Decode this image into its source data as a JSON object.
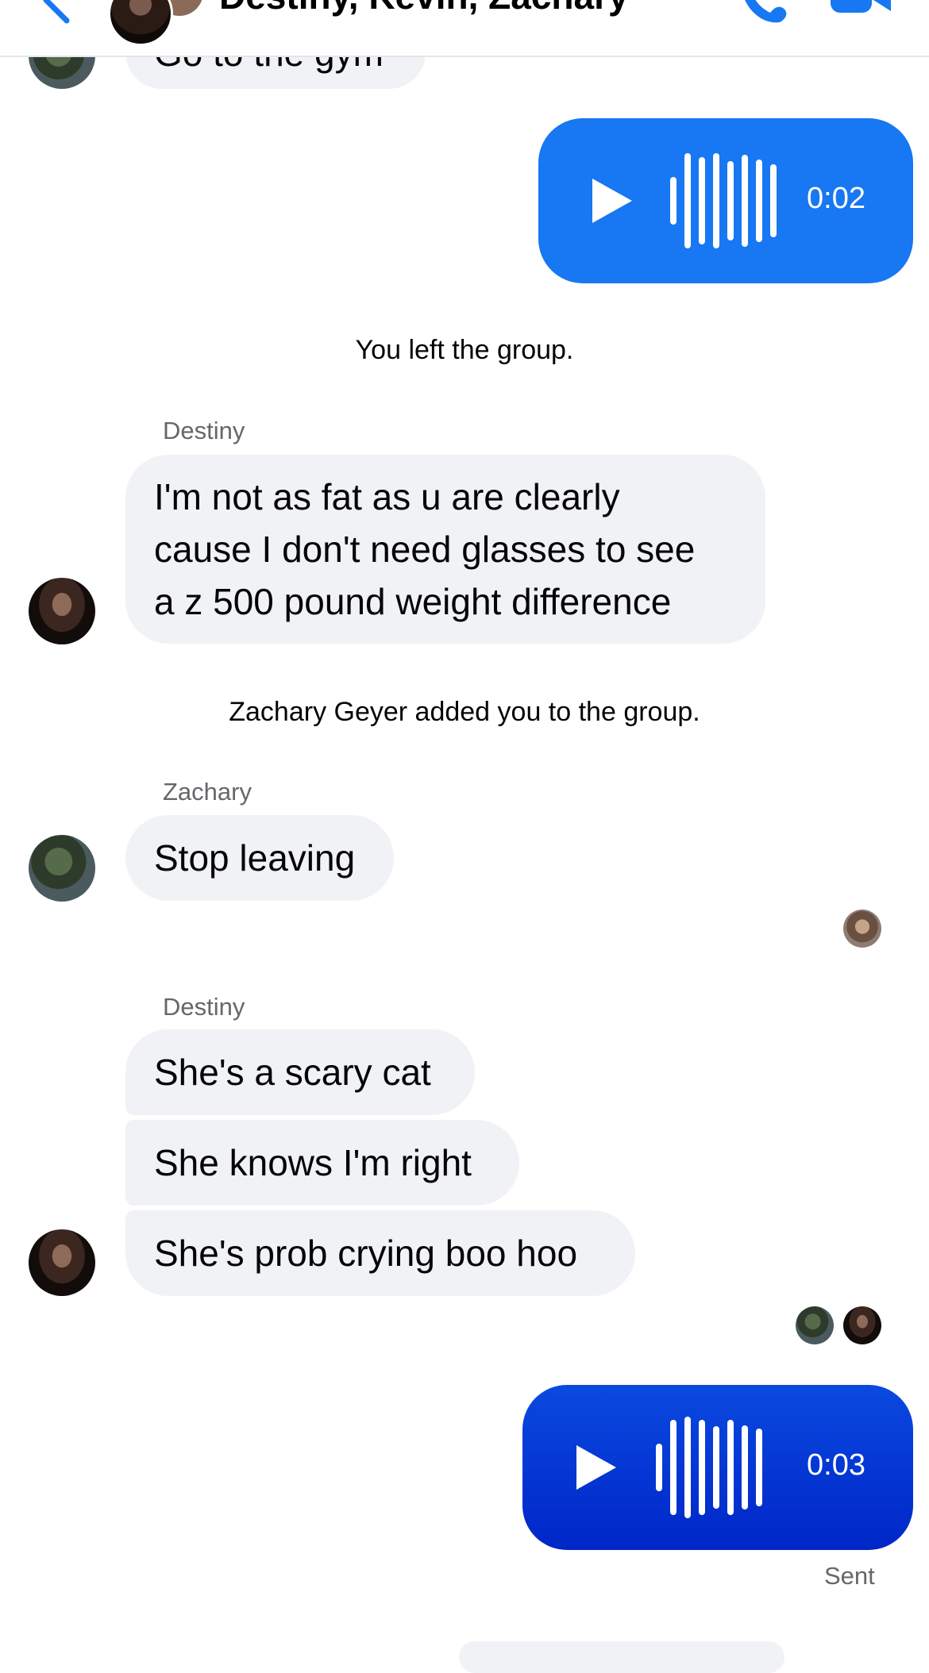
{
  "header": {
    "title": "Destiny, Kevin, Zachary"
  },
  "messages": {
    "gym_text": "Go to the gym",
    "audio1_duration": "0:02",
    "system_left": "You left the group.",
    "destiny_name_1": "Destiny",
    "destiny_msg_1_line1": "I'm not as fat as u are clearly",
    "destiny_msg_1_line2": "cause I don't need glasses to see",
    "destiny_msg_1_line3": "a z 500 pound weight difference",
    "system_added": "Zachary Geyer added you to the group.",
    "zachary_name": "Zachary",
    "zachary_msg": "Stop leaving",
    "destiny_name_2": "Destiny",
    "destiny_msg_2": "She's a scary cat",
    "destiny_msg_3": "She knows I'm right",
    "destiny_msg_4": "She's prob crying boo hoo",
    "audio2_duration": "0:03",
    "status": "Sent"
  },
  "colors": {
    "accent": "#1877f2",
    "audio1": "#1877f2",
    "audio2_top": "#0a49e0",
    "audio2_bottom": "#0026c8",
    "bubble_incoming": "#f0f2f5"
  },
  "icons": [
    "back-chevron-icon",
    "phone-icon",
    "video-camera-icon",
    "play-icon",
    "waveform-icon"
  ]
}
